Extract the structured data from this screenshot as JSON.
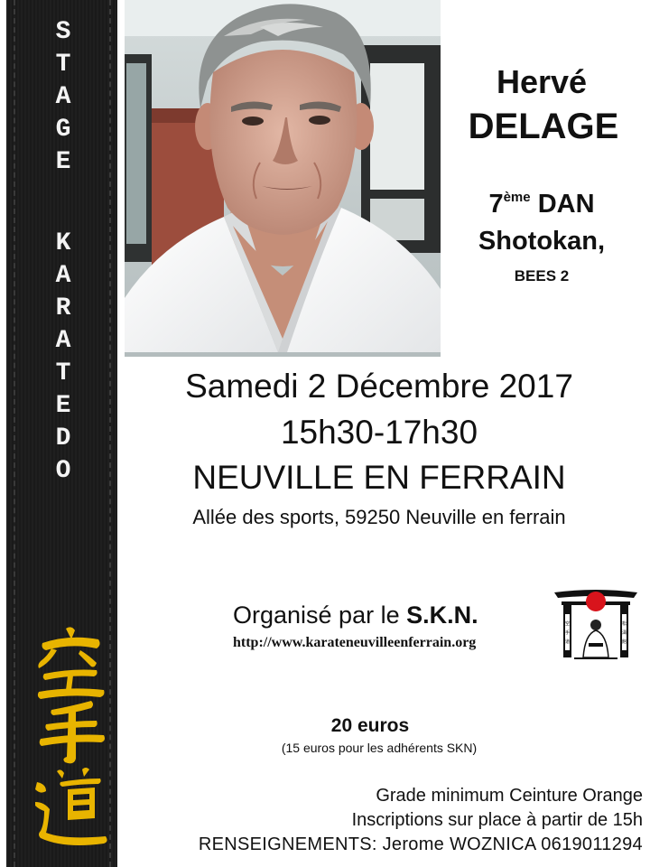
{
  "belt": {
    "letters": [
      "S",
      "T",
      "A",
      "G",
      "E",
      "K",
      "A",
      "R",
      "A",
      "T",
      "E",
      "D",
      "O"
    ],
    "kanji": "空手道"
  },
  "instructor": {
    "first_name": "Hervé",
    "last_name": "DELAGE",
    "dan_number": "7",
    "dan_suffix": "ème",
    "dan_label": "DAN",
    "style": "Shotokan,",
    "diploma": "BEES 2"
  },
  "event": {
    "date": "Samedi 2 Décembre 2017",
    "time": "15h30-17h30",
    "town": "NEUVILLE EN FERRAIN",
    "address": "Allée des sports, 59250 Neuville en ferrain"
  },
  "organizer": {
    "prefix": "Organisé par le",
    "club": "S.K.N.",
    "url": "http://www.karateneuvilleenferrain.org"
  },
  "pricing": {
    "price": "20 euros",
    "member_note": "(15 euros pour les adhérents SKN)"
  },
  "info": {
    "grade": "Grade minimum Ceinture Orange",
    "registration": "Inscriptions sur place à partir de 15h",
    "contact": "RENSEIGNEMENTS: Jerome WOZNICA 0619011294"
  },
  "colors": {
    "belt": "#1b1b1b",
    "kanji_gold": "#e8b400",
    "logo_red": "#d8141c"
  }
}
